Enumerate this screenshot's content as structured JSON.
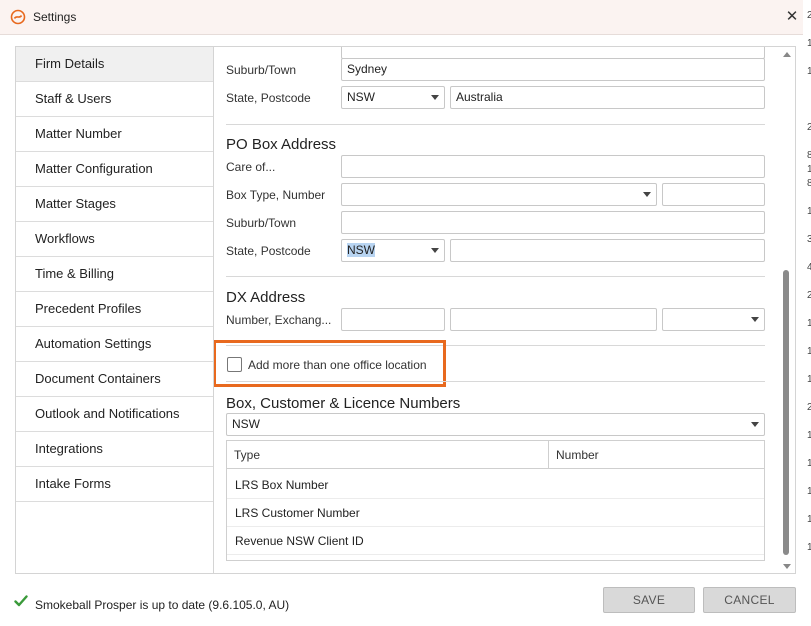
{
  "window": {
    "title": "Settings",
    "close_glyph": "✕"
  },
  "sidebar": {
    "items": [
      {
        "label": "Firm Details"
      },
      {
        "label": "Staff & Users"
      },
      {
        "label": "Matter Number"
      },
      {
        "label": "Matter Configuration"
      },
      {
        "label": "Matter Stages"
      },
      {
        "label": "Workflows"
      },
      {
        "label": "Time & Billing"
      },
      {
        "label": "Precedent Profiles"
      },
      {
        "label": "Automation Settings"
      },
      {
        "label": "Document Containers"
      },
      {
        "label": "Outlook and Notifications"
      },
      {
        "label": "Integrations"
      },
      {
        "label": "Intake Forms"
      }
    ]
  },
  "street_address": {
    "suburb_label": "Suburb/Town",
    "suburb_value": "Sydney",
    "state_label": "State, Postcode",
    "state_value": "NSW",
    "postcode_value": "Australia"
  },
  "po_box": {
    "title": "PO Box Address",
    "care_of_label": "Care of...",
    "box_type_label": "Box Type, Number",
    "suburb_label": "Suburb/Town",
    "state_label": "State, Postcode",
    "state_value": "NSW"
  },
  "dx": {
    "title": "DX Address",
    "number_label": "Number, Exchang..."
  },
  "office": {
    "checkbox_label": "Add more than one office location",
    "checked": false
  },
  "numbers": {
    "title": "Box, Customer & Licence Numbers",
    "state_value": "NSW",
    "columns": [
      "Type",
      "Number"
    ],
    "rows": [
      {
        "type": "LRS Box Number",
        "number": ""
      },
      {
        "type": "LRS Customer Number",
        "number": ""
      },
      {
        "type": "Revenue NSW Client ID",
        "number": ""
      }
    ]
  },
  "footer": {
    "status": "Smokeball Prosper is up to date (9.6.105.0, AU)",
    "save_label": "SAVE",
    "cancel_label": "CANCEL"
  },
  "edge_chars": [
    "2",
    "1",
    "1",
    "2",
    "8",
    "1",
    "8",
    "1",
    "3",
    "4",
    "2",
    "1",
    "1",
    "1",
    "2",
    "1",
    "1",
    "1",
    "1",
    "1"
  ],
  "colors": {
    "accent_orange": "#e8691e",
    "status_green": "#3a9a3a",
    "logo_orange": "#e8691e"
  }
}
